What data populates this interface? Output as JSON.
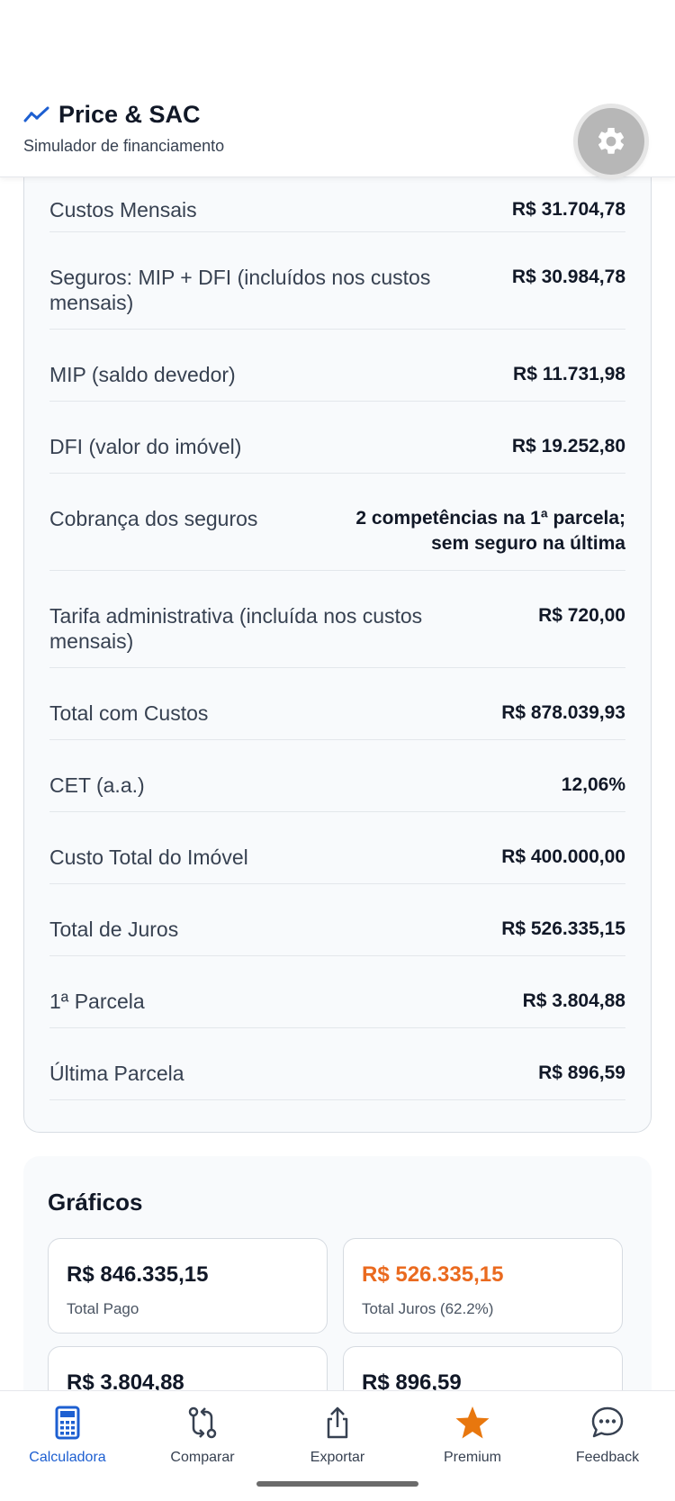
{
  "header": {
    "title": "Price & SAC",
    "subtitle": "Simulador de financiamento",
    "brand_color": "#1d5fd1",
    "settings_icon": "gear-icon"
  },
  "summary_rows": [
    {
      "label": "Custos Mensais",
      "value": "R$ 31.704,78"
    },
    {
      "label": "Seguros: MIP + DFI (incluídos nos custos mensais)",
      "value": "R$ 30.984,78"
    },
    {
      "label": "MIP (saldo devedor)",
      "value": "R$ 11.731,98"
    },
    {
      "label": "DFI (valor do imóvel)",
      "value": "R$ 19.252,80"
    },
    {
      "label": "Cobrança dos seguros",
      "value": "2 competências na 1ª parcela; sem seguro na última"
    },
    {
      "label": "Tarifa administrativa (incluída nos custos mensais)",
      "value": "R$ 720,00"
    },
    {
      "label": "Total com Custos",
      "value": "R$ 878.039,93"
    },
    {
      "label": "CET (a.a.)",
      "value": "12,06%"
    },
    {
      "label": "Custo Total do Imóvel",
      "value": "R$ 400.000,00"
    },
    {
      "label": "Total de Juros",
      "value": "R$ 526.335,15"
    },
    {
      "label": "1ª Parcela",
      "value": "R$ 3.804,88"
    },
    {
      "label": "Última Parcela",
      "value": "R$ 896,59"
    }
  ],
  "charts_section": {
    "title": "Gráficos",
    "stats": [
      {
        "amount": "R$ 846.335,15",
        "caption": "Total Pago"
      },
      {
        "amount": "R$ 526.335,15",
        "caption": "Total Juros (62.2%)",
        "accent": "#ea6a1f"
      },
      {
        "amount": "R$ 3.804,88",
        "caption": ""
      },
      {
        "amount": "R$ 896,59",
        "caption": ""
      }
    ]
  },
  "bottom_nav": [
    {
      "label": "Calculadora",
      "icon": "calculator-icon",
      "active": true
    },
    {
      "label": "Comparar",
      "icon": "compare-icon"
    },
    {
      "label": "Exportar",
      "icon": "share-icon"
    },
    {
      "label": "Premium",
      "icon": "star-icon",
      "icon_color": "#e8770e"
    },
    {
      "label": "Feedback",
      "icon": "chat-bubble-icon"
    }
  ]
}
